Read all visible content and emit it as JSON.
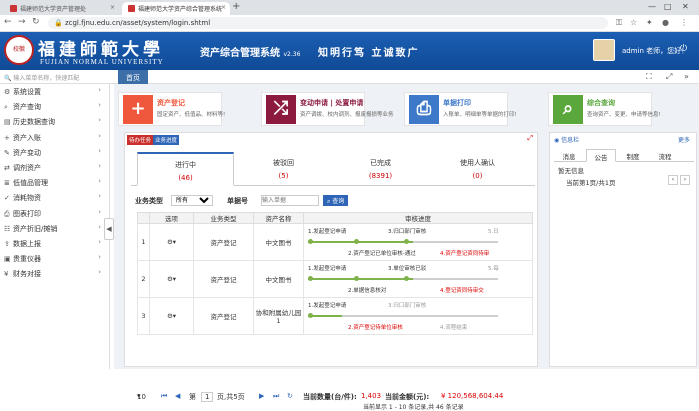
{
  "browser": {
    "tabs": [
      {
        "title": "福建师范大学资产管理处"
      },
      {
        "title": "福建师范大学资产综合管理系统"
      }
    ],
    "url": "zcgl.fjnu.edu.cn/asset/system/login.shtml",
    "accent": "#dee1e6"
  },
  "header": {
    "university_cn": "福建師範大學",
    "university_en": "FUJIAN NORMAL UNIVERSITY",
    "system_name": "资产综合管理系统",
    "version": "v2.36",
    "motto": "知明行笃 立诚致广",
    "user": "admin 老师，您好！",
    "brand_color": "#1c5fb3"
  },
  "search": {
    "placeholder": "输入菜单名称，快速匹配"
  },
  "pagebar": {
    "home": "首页"
  },
  "sidebar": {
    "items": [
      {
        "icon": "gear-icon",
        "label": "系统设置"
      },
      {
        "icon": "search-icon",
        "label": "资产查询"
      },
      {
        "icon": "file-icon",
        "label": "历史数据查询"
      },
      {
        "icon": "plus-icon",
        "label": "资产入账"
      },
      {
        "icon": "pencil-icon",
        "label": "资产变动"
      },
      {
        "icon": "transfer-icon",
        "label": "调剂资产"
      },
      {
        "icon": "list-icon",
        "label": "低值品管理"
      },
      {
        "icon": "check-icon",
        "label": "消耗物资"
      },
      {
        "icon": "print-icon",
        "label": "图表打印"
      },
      {
        "icon": "list-icon",
        "label": "资产折旧/摊销"
      },
      {
        "icon": "upload-icon",
        "label": "数据上报"
      },
      {
        "icon": "instrument-icon",
        "label": "贵重仪器"
      },
      {
        "icon": "money-icon",
        "label": "财务对接"
      }
    ]
  },
  "cards": [
    {
      "icon": "plus-icon",
      "title": "资产登记",
      "sub": "固定资产、低值品、材料等!",
      "color": "#f0583d",
      "title_color": "#f0583d"
    },
    {
      "icon": "shuffle-icon",
      "title": "变动申请 | 处置申请",
      "sub": "资产调拨、校内调剂、报废报损等业务",
      "color": "#8b1a3e",
      "title_color": "#8b1a3e"
    },
    {
      "icon": "print-icon",
      "title": "单据打印",
      "sub": "入账单、明细单等单据的打印!",
      "color": "#3d78c9",
      "title_color": "#3d78c9"
    },
    {
      "icon": "search-icon",
      "title": "综合查询",
      "sub": "查询资产、变更、申请等信息!",
      "color": "#5aa83c",
      "title_color": "#5aa83c"
    }
  ],
  "tasks": {
    "label_todo": "待办任务",
    "label_progress": "业务进度",
    "tabs": [
      {
        "label": "进行中",
        "count": "(46)"
      },
      {
        "label": "被驳回",
        "count": "(5)"
      },
      {
        "label": "已完成",
        "count": "(8391)"
      },
      {
        "label": "使用人确认",
        "count": "(0)"
      }
    ],
    "filter": {
      "type_label": "业务类型",
      "type_value": "所有",
      "no_label": "单据号",
      "no_placeholder": "输入单据",
      "query": "查询"
    },
    "columns": [
      "选项",
      "业务类型",
      "资产名称",
      "审核进度"
    ],
    "rows": [
      {
        "num": "1",
        "type": "资产登记",
        "name": "中文图书",
        "steps_top": [
          "1.发起登记申请",
          "3.归口部门审核",
          "5.日"
        ],
        "steps_bottom": [
          "2.资产登记已单位审核-通过",
          "4.资产登记资同待审"
        ],
        "done": 0.55
      },
      {
        "num": "2",
        "type": "资产登记",
        "name": "中文图书",
        "steps_top": [
          "1.发起登记申请",
          "3.单位审核已驳",
          "5.每"
        ],
        "steps_bottom": [
          "2.单据信息核对",
          "4.登记资同待审交"
        ],
        "done": 0.55
      },
      {
        "num": "3",
        "type": "资产登记",
        "name": "协和附属幼儿园1",
        "steps_top": [
          "1.发起登记申请",
          "3.归口部门审核"
        ],
        "steps_bottom": [
          "2.资产登记待单位审核",
          "4.流程结束"
        ],
        "done": 0.18
      }
    ],
    "pager": {
      "size": "10",
      "prefix": "第",
      "page": "1",
      "suffix": "页,共5页",
      "count_label": "当前数量(台/件):",
      "count": "1,403",
      "amount_label": "当前金额(元):",
      "amount": "¥ 120,568,604.44",
      "summary": "当前显示 1 - 10 条记录,共 46 条记录"
    }
  },
  "info": {
    "title": "信息栏",
    "more": "更多",
    "tabs": [
      "消息",
      "公告",
      "制度",
      "流程"
    ],
    "empty": "暂无信息",
    "page": "当前第1页/共1页"
  }
}
